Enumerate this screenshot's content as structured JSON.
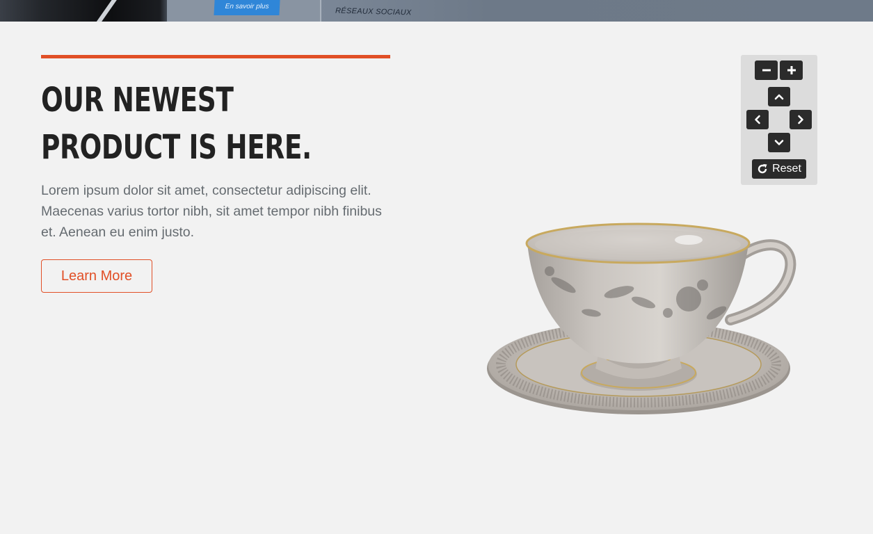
{
  "top_banner": {
    "button_text": "En savoir plus",
    "section_text": "RÉSEAUX SOCIAUX"
  },
  "hero": {
    "headline": "Our Newest Product is here.",
    "body": "Lorem ipsum dolor sit amet, consectetur adipiscing elit. Maecenas varius tortor nibh, sit amet tempor nibh finibus et. Aenean eu enim justo.",
    "cta_label": "Learn More"
  },
  "viewer_controls": {
    "zoom_out_icon": "minus-icon",
    "zoom_in_icon": "plus-icon",
    "up_icon": "chevron-up-icon",
    "left_icon": "chevron-left-icon",
    "right_icon": "chevron-right-icon",
    "down_icon": "chevron-down-icon",
    "reset_icon": "rotate-icon",
    "reset_label": "Reset"
  },
  "colors": {
    "accent": "#e14f26",
    "background": "#f2f2f2",
    "heading": "#222222",
    "body_text": "#656b70",
    "control_button": "#2b2b2b",
    "control_panel": "#dcdcdc"
  }
}
